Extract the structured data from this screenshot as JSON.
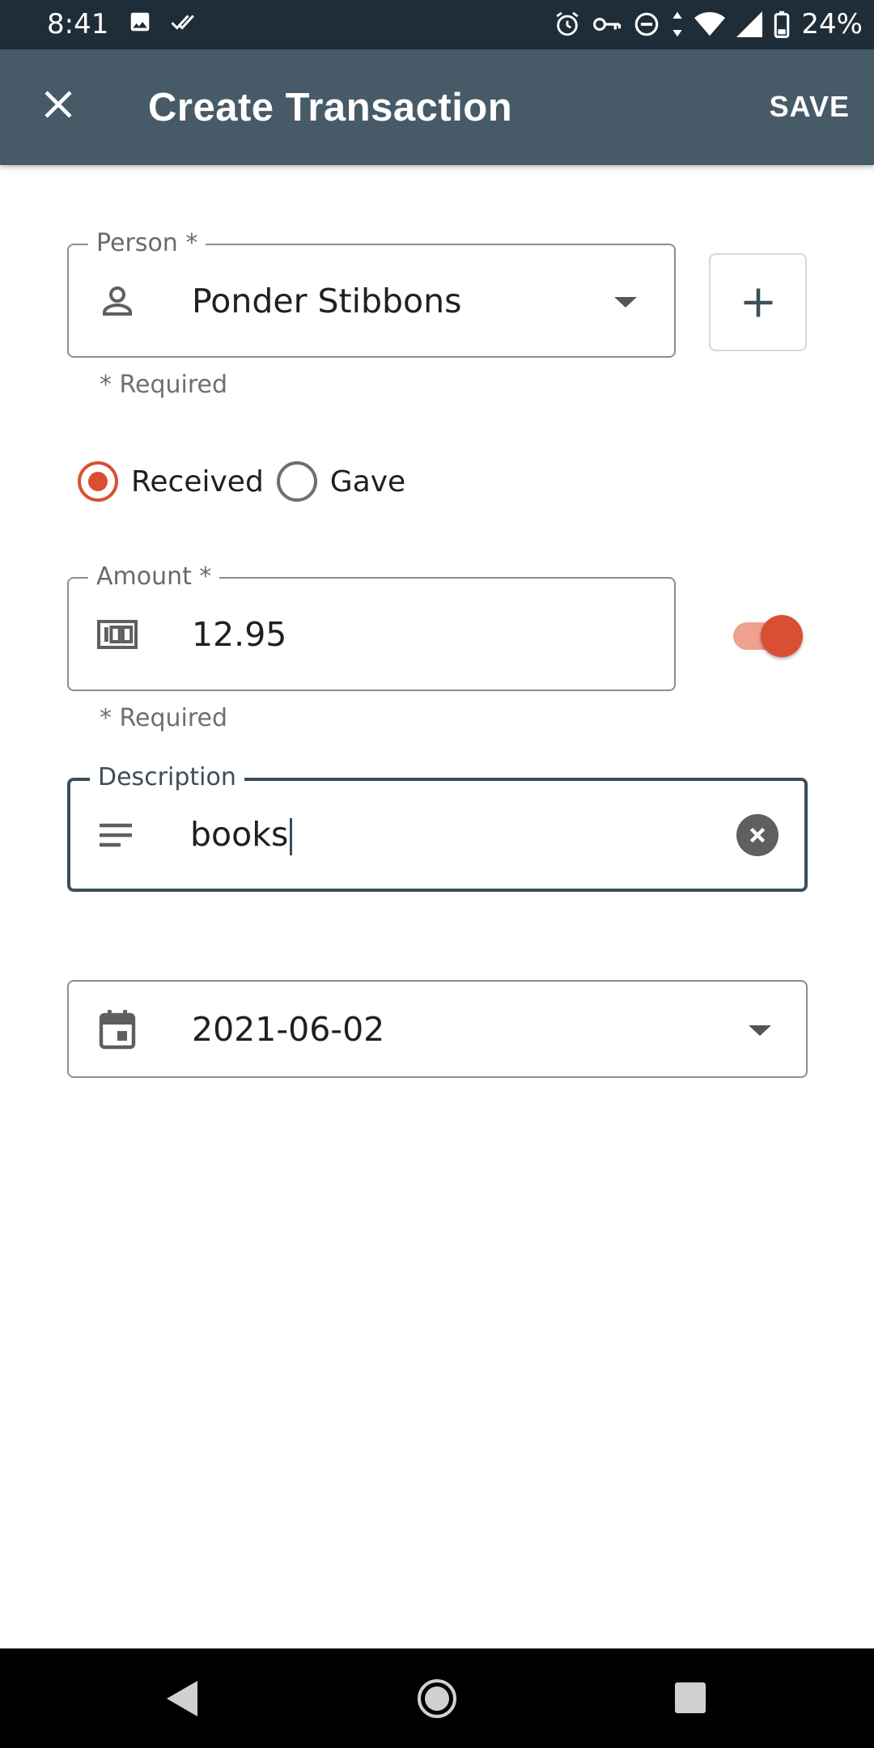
{
  "status_bar": {
    "time": "8:41",
    "battery": "24%",
    "icons": [
      "image-icon",
      "double-check-icon",
      "alarm-icon",
      "vpn-key-icon",
      "do-not-disturb-icon",
      "data-arrows-icon",
      "wifi-icon",
      "signal-icon",
      "battery-icon"
    ]
  },
  "app_bar": {
    "title": "Create Transaction",
    "save_label": "SAVE",
    "close_icon": "close-icon"
  },
  "person_field": {
    "label": "Person *",
    "value": "Ponder Stibbons",
    "helper": "* Required",
    "icon": "person-icon"
  },
  "add_person": {
    "icon": "plus-icon"
  },
  "direction": {
    "options": [
      {
        "label": "Received",
        "checked": true
      },
      {
        "label": "Gave",
        "checked": false
      }
    ]
  },
  "amount_field": {
    "label": "Amount *",
    "value": "12.95",
    "helper": "* Required",
    "icon": "money-icon"
  },
  "amount_toggle": {
    "on": true
  },
  "description_field": {
    "label": "Description",
    "value": "books",
    "icon": "notes-icon"
  },
  "date_field": {
    "value": "2021-06-02",
    "icon": "calendar-icon"
  },
  "colors": {
    "accent": "#d94f33",
    "app_bar": "#475a68",
    "status_bar": "#1f2d38"
  }
}
